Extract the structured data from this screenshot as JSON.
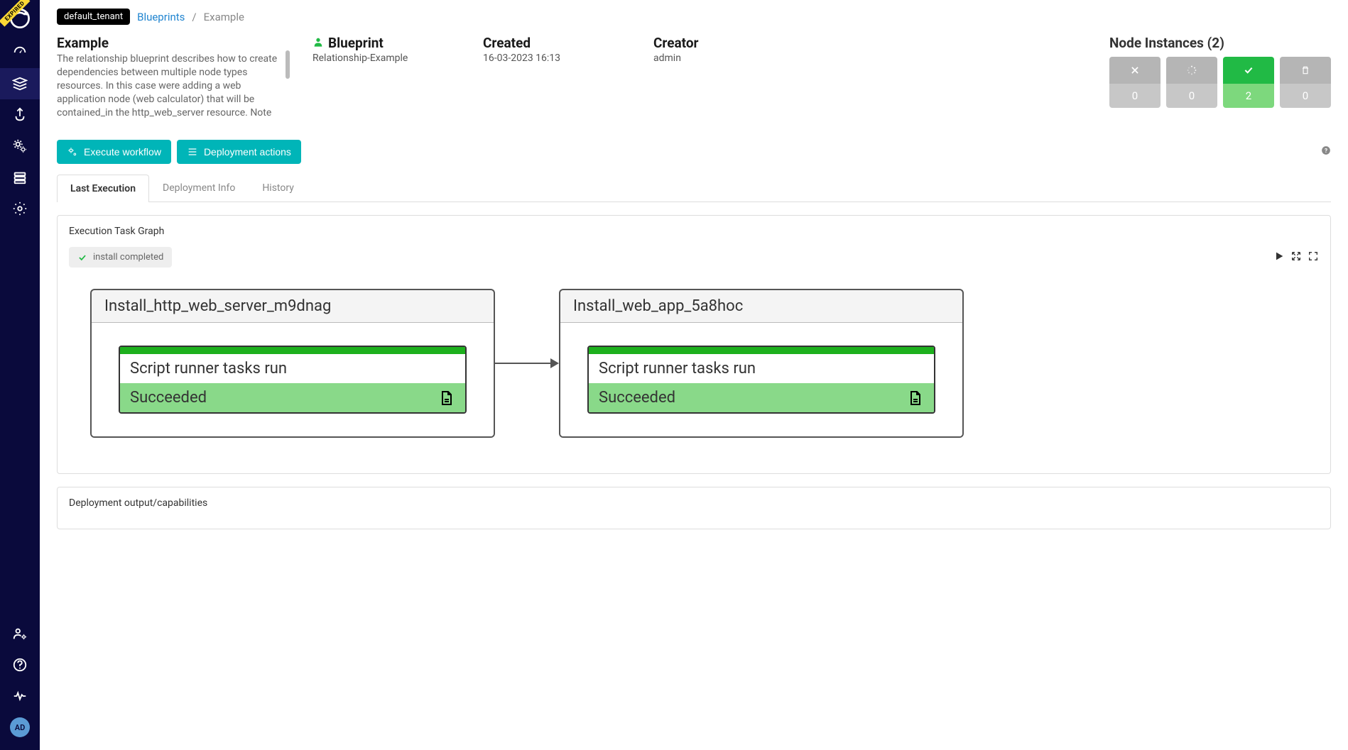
{
  "sidebar": {
    "expired_label": "EXPIRED",
    "avatar": "AD"
  },
  "breadcrumb": {
    "tenant": "default_tenant",
    "link": "Blueprints",
    "separator": "/",
    "current": "Example"
  },
  "header": {
    "name": "Example",
    "description": "The relationship blueprint describes how to create dependencies between multiple node types resources. In this case were adding a web application node (web calculator) that will be contained_in the http_web_server resource. Note that the application is",
    "blueprint_label": "Blueprint",
    "blueprint_value": "Relationship-Example",
    "created_label": "Created",
    "created_value": "16-03-2023 16:13",
    "creator_label": "Creator",
    "creator_value": "admin",
    "node_instances_label": "Node Instances (2)",
    "statuses": [
      {
        "count": "0",
        "style": "grey",
        "icon": "x"
      },
      {
        "count": "0",
        "style": "grey",
        "icon": "spinner"
      },
      {
        "count": "2",
        "style": "green",
        "icon": "check"
      },
      {
        "count": "0",
        "style": "grey",
        "icon": "trash"
      }
    ]
  },
  "actions": {
    "execute": "Execute workflow",
    "deployment": "Deployment actions"
  },
  "tabs": [
    {
      "label": "Last Execution",
      "active": true
    },
    {
      "label": "Deployment Info",
      "active": false
    },
    {
      "label": "History",
      "active": false
    }
  ],
  "graph": {
    "panel_title": "Execution Task Graph",
    "status_badge": "install completed",
    "nodes": [
      {
        "title": "Install_http_web_server_m9dnag",
        "task": "Script runner tasks run",
        "status": "Succeeded"
      },
      {
        "title": "Install_web_app_5a8hoc",
        "task": "Script runner tasks run",
        "status": "Succeeded"
      }
    ]
  },
  "bottom_panel": {
    "title": "Deployment output/capabilities"
  }
}
